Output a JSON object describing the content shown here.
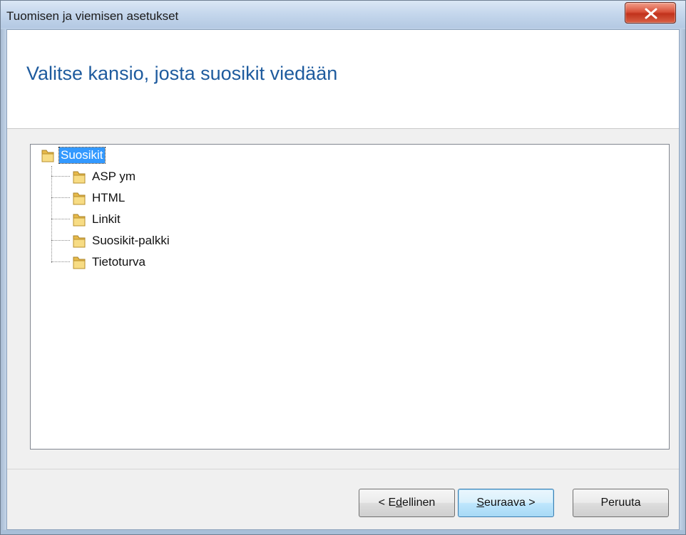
{
  "window": {
    "title": "Tuomisen ja viemisen asetukset",
    "close_icon": "close-x-icon"
  },
  "header": {
    "title": "Valitse kansio, josta suosikit viedään"
  },
  "tree": {
    "root": {
      "label": "Suosikit",
      "icon": "folder-icon",
      "selected": true
    },
    "children": [
      {
        "label": "ASP ym",
        "icon": "folder-icon"
      },
      {
        "label": "HTML",
        "icon": "folder-icon"
      },
      {
        "label": "Linkit",
        "icon": "folder-icon"
      },
      {
        "label": "Suosikit-palkki",
        "icon": "folder-icon"
      },
      {
        "label": "Tietoturva",
        "icon": "folder-icon"
      }
    ]
  },
  "buttons": {
    "back_prefix": "< E",
    "back_mnemonic": "d",
    "back_suffix": "ellinen",
    "next_mnemonic": "S",
    "next_suffix": "euraava >",
    "cancel": "Peruuta"
  },
  "colors": {
    "title_blue": "#1e5b9e",
    "selection": "#3399ff",
    "close_red": "#c1321c"
  }
}
